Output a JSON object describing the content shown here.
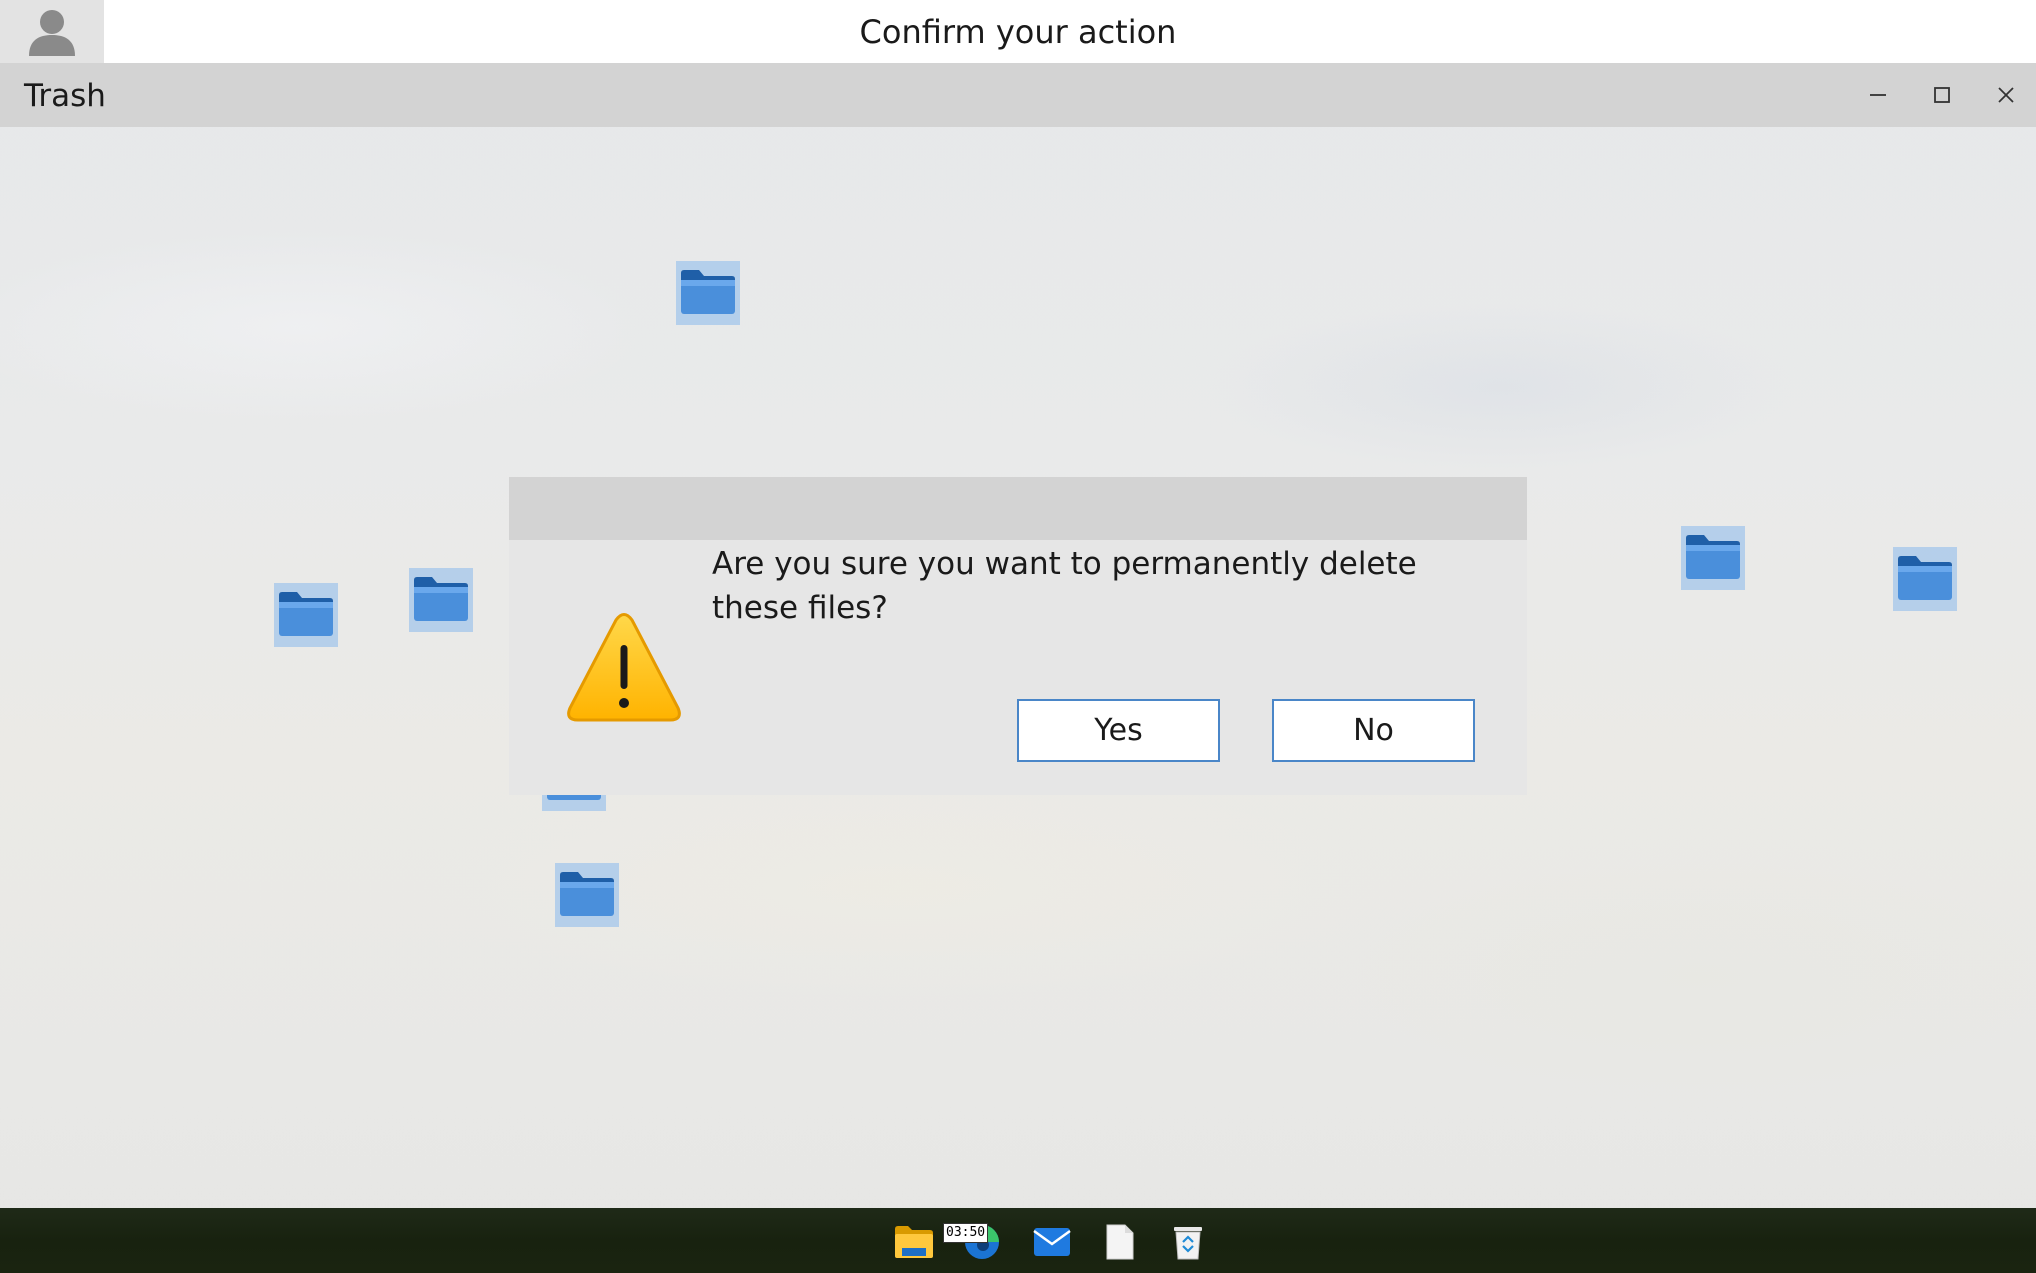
{
  "top_bar": {
    "title": "Confirm your action",
    "avatar_icon": "user-avatar-icon"
  },
  "window": {
    "title": "Trash",
    "controls": [
      "minimize-icon",
      "maximize-icon",
      "close-icon"
    ]
  },
  "desktop": {
    "folder_icon": "folder-icon",
    "folder_count": 8
  },
  "dialog": {
    "message": "Are you sure you want to permanently delete these files?",
    "icon": "warning-icon",
    "yes_label": "Yes",
    "no_label": "No",
    "button_border_color": "#4a86c8"
  },
  "taskbar": {
    "clock": "03:50",
    "apps": [
      "file-explorer-icon",
      "edge-browser-icon",
      "mail-icon",
      "document-icon",
      "recycle-bin-icon"
    ]
  },
  "colors": {
    "title_bar": "#d3d3d3",
    "dialog_bg": "#e6e6e6",
    "folder_highlight": "#a3c6eb",
    "warning_yellow": "#ffc107"
  }
}
